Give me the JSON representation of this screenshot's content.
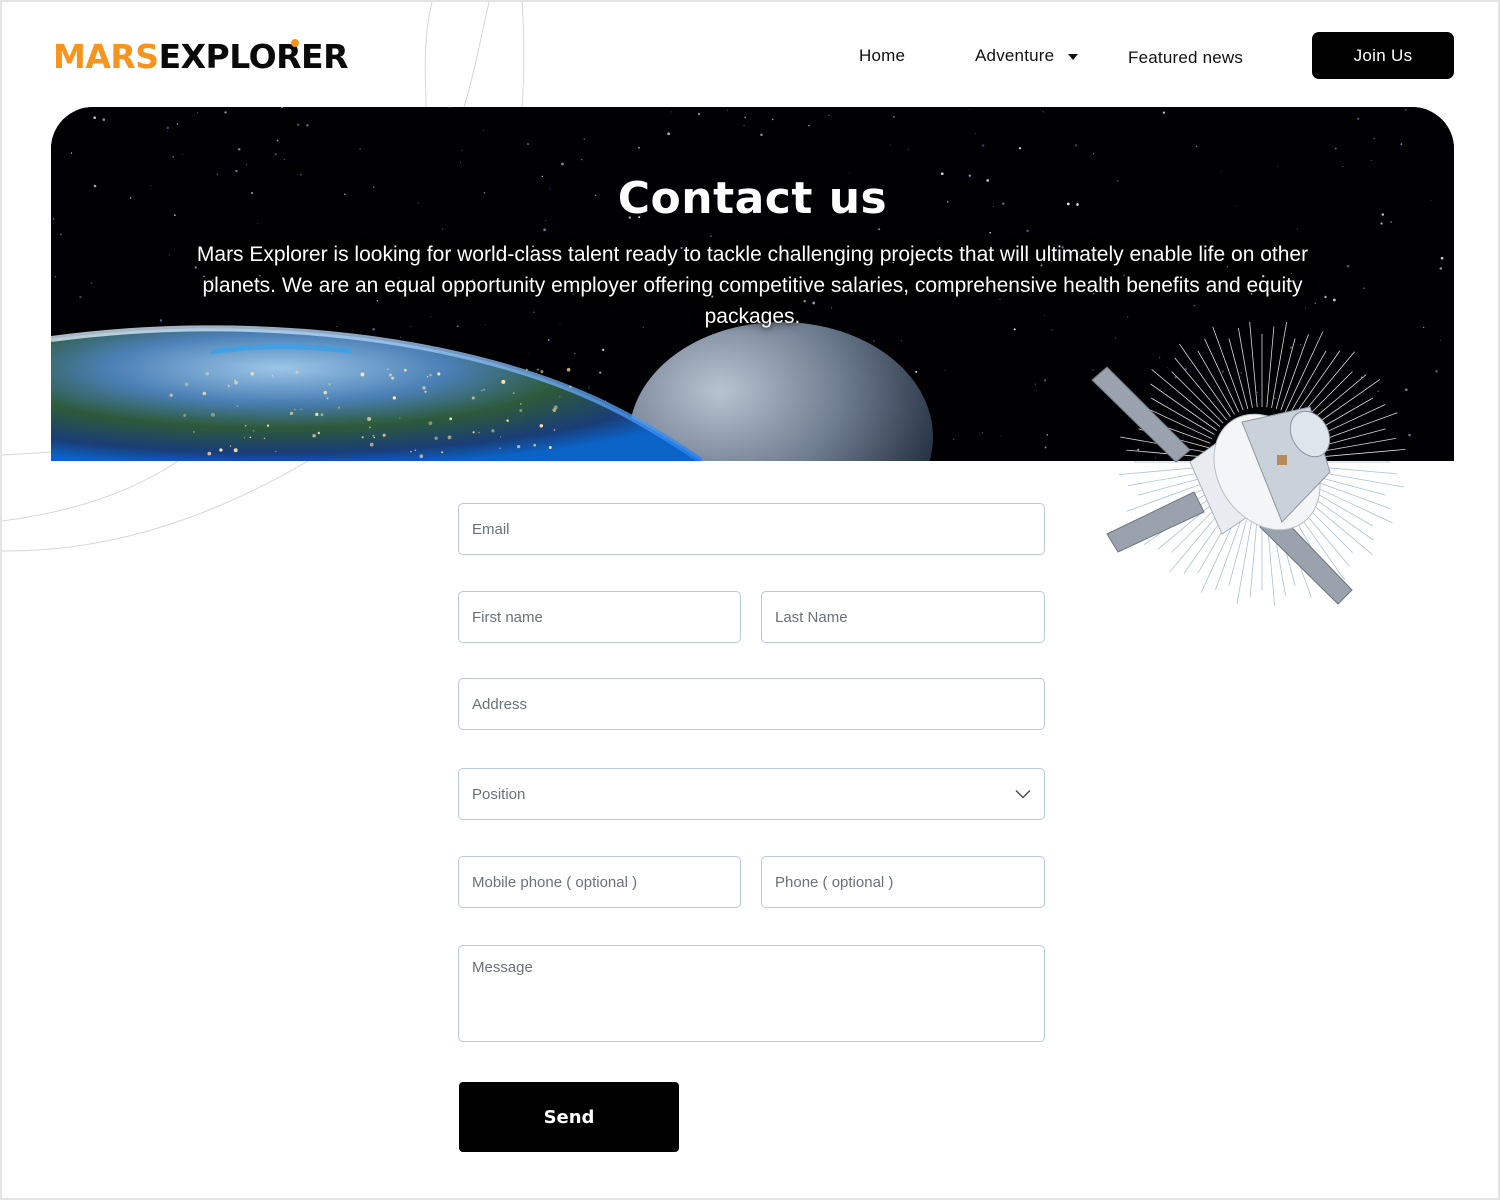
{
  "brand": {
    "logo_part1": "MARS",
    "logo_part2": "EXPLORER",
    "primary_color": "#f7941d",
    "dark_color": "#000000"
  },
  "nav": {
    "items": [
      {
        "label": "Home"
      },
      {
        "label": "Adventure",
        "has_dropdown": true,
        "icon": "caret-down-icon"
      },
      {
        "label": "Featured news"
      }
    ],
    "cta_label": "Join Us"
  },
  "hero": {
    "title": "Contact us",
    "description": "Mars Explorer is looking for world-class talent ready to tackle challenging projects that will ultimately enable life on other planets. We are an equal opportunity employer offering competitive salaries, comprehensive health benefits and equity packages."
  },
  "form": {
    "email_placeholder": "Email",
    "first_name_placeholder": "First name",
    "last_name_placeholder": "Last Name",
    "address_placeholder": "Address",
    "position_label": "Position",
    "position_icon": "chevron-down-icon",
    "mobile_placeholder": "Mobile phone ( optional )",
    "phone_placeholder": "Phone ( optional )",
    "message_placeholder": "Message",
    "submit_label": "Send"
  }
}
